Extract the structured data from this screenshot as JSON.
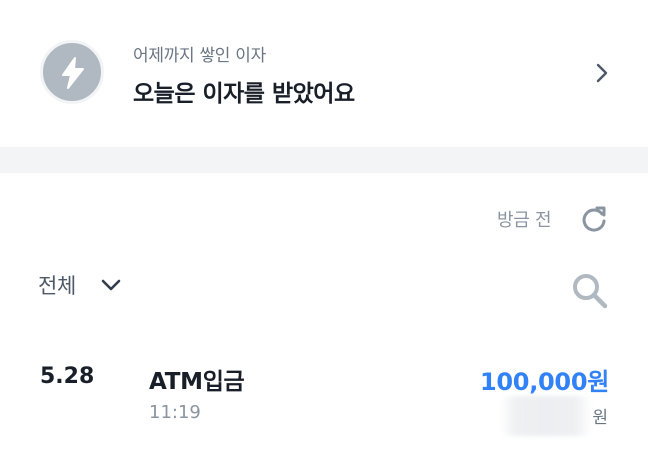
{
  "interest": {
    "subtitle": "어제까지 쌓인 이자",
    "title": "오늘은 이자를 받았어요"
  },
  "history": {
    "refresh_label": "방금 전",
    "filter_label": "전체"
  },
  "transactions": [
    {
      "date": "5.28",
      "title": "ATM입금",
      "time": "11:19",
      "amount": "100,000원",
      "balance_unit": "원"
    }
  ],
  "colors": {
    "accent": "#3182f6",
    "badge": "#b0b8c1",
    "divider": "#f2f4f6"
  }
}
